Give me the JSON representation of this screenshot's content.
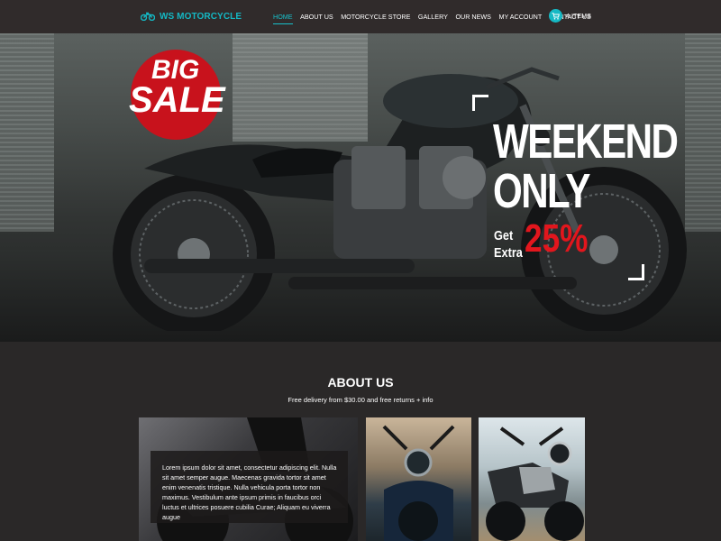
{
  "header": {
    "logo_text": "WS MOTORCYCLE",
    "nav": [
      {
        "label": "HOME",
        "active": true
      },
      {
        "label": "ABOUT US"
      },
      {
        "label": "MOTORCYCLE STORE"
      },
      {
        "label": "GALLERY"
      },
      {
        "label": "OUR NEWS"
      },
      {
        "label": "MY ACCOUNT"
      },
      {
        "label": "CONTACT US"
      }
    ],
    "cart_label": "4 ITEMS",
    "cart_icon": "cart-icon"
  },
  "hero": {
    "badge_line1": "BIG",
    "badge_line2": "SALE",
    "headline1": "WEEKEND",
    "headline2": "ONLY",
    "offer_line1": "Get",
    "offer_line2": "Extra",
    "offer_value": "25%"
  },
  "about": {
    "title": "ABOUT US",
    "subtitle": "Free delivery from $30.00 and free returns + info",
    "card_text": "Lorem ipsum dolor sit amet, consectetur adipiscing elit. Nulla sit amet semper augue. Maecenas gravida tortor sit amet enim venenatis tristique. Nulla vehicula porta tortor non maximus. Vestibulum ante ipsum primis in faucibus orci luctus et ultrices posuere cubilia Curae; Aliquam eu viverra augue"
  },
  "colors": {
    "accent": "#14b8c4",
    "header_bg": "#302b2b",
    "page_bg": "#2a2828",
    "sale_red": "#c8121c",
    "offer_red": "#e2161d"
  }
}
